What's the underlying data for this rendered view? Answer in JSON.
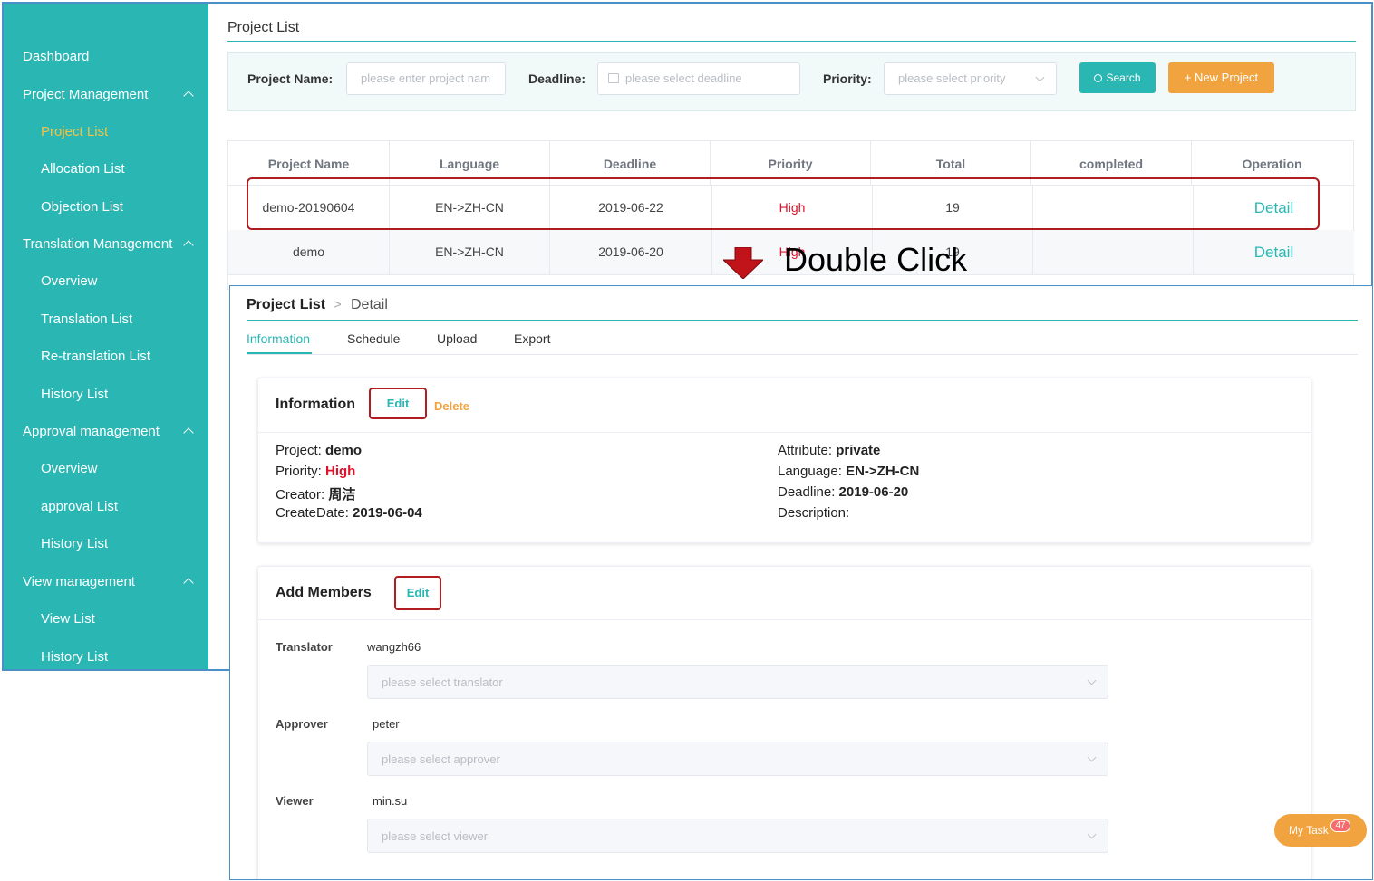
{
  "sidebar": {
    "items": [
      {
        "label": "Dashboard"
      },
      {
        "label": "Project Management"
      },
      {
        "label": "Project List"
      },
      {
        "label": "Allocation List"
      },
      {
        "label": "Objection List"
      },
      {
        "label": "Translation Management"
      },
      {
        "label": "Overview"
      },
      {
        "label": "Translation List"
      },
      {
        "label": "Re-translation List"
      },
      {
        "label": "History List"
      },
      {
        "label": "Approval management"
      },
      {
        "label": "Overview"
      },
      {
        "label": "approval List"
      },
      {
        "label": "History List"
      },
      {
        "label": "View management"
      },
      {
        "label": "View List"
      },
      {
        "label": "History List"
      }
    ]
  },
  "project_list": {
    "heading": "Project List",
    "filters": {
      "name_label": "Project Name:",
      "name_placeholder": "please enter project nam",
      "deadline_label": "Deadline:",
      "deadline_placeholder": "please select deadline",
      "priority_label": "Priority:",
      "priority_placeholder": "please select priority",
      "search_label": "Search",
      "new_project_label": "+ New Project"
    },
    "columns": [
      "Project Name",
      "Language",
      "Deadline",
      "Priority",
      "Total",
      "completed",
      "Operation"
    ],
    "rows": [
      {
        "name": "demo-20190604",
        "language": "EN->ZH-CN",
        "deadline": "2019-06-22",
        "priority": "High",
        "total": "19",
        "completed": "",
        "operation": "Detail"
      },
      {
        "name": "demo",
        "language": "EN->ZH-CN",
        "deadline": "2019-06-20",
        "priority": "High",
        "total": "19",
        "completed": "",
        "operation": "Detail"
      }
    ]
  },
  "annotation": {
    "caption": "Double Click",
    "arrow_color": "#c0141a",
    "highlight_color": "#b01c20"
  },
  "detail": {
    "breadcrumb": {
      "root": "Project List",
      "separator": ">",
      "current": "Detail"
    },
    "tabs": [
      "Information",
      "Schedule",
      "Upload",
      "Export"
    ],
    "info_card": {
      "title": "Information",
      "edit_label": "Edit",
      "delete_label": "Delete",
      "fields": {
        "project": {
          "label": "Project: ",
          "value": "demo"
        },
        "priority": {
          "label": "Priority: ",
          "value": "High"
        },
        "creator": {
          "label": "Creator: ",
          "value": "周洁"
        },
        "create_date": {
          "label": "CreateDate: ",
          "value": "2019-06-04"
        },
        "attribute": {
          "label": "Attribute: ",
          "value": "private"
        },
        "language": {
          "label": "Language: ",
          "value": "EN->ZH-CN"
        },
        "deadline": {
          "label": "Deadline: ",
          "value": "2019-06-20"
        },
        "description": {
          "label": "Description:",
          "value": ""
        }
      }
    },
    "members_card": {
      "title": "Add Members",
      "edit_label": "Edit",
      "translator": {
        "label": "Translator",
        "value": "wangzh66",
        "placeholder": "please select translator"
      },
      "approver": {
        "label": "Approver",
        "value": "peter",
        "placeholder": "please select approver"
      },
      "viewer": {
        "label": "Viewer",
        "value": "min.su",
        "placeholder": "please select viewer"
      }
    }
  },
  "my_task": {
    "label": "My Task",
    "count": "47"
  },
  "colors": {
    "accent": "#2ab7b4",
    "orange": "#f0a33e",
    "danger": "#e0102a",
    "active_nav": "#f5c242"
  }
}
